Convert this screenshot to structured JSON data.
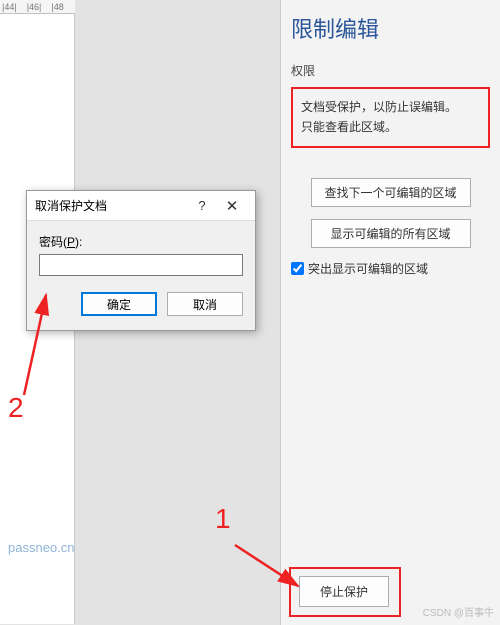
{
  "ruler": {
    "marks": [
      "|44|",
      "|46|",
      "|48"
    ]
  },
  "panel": {
    "title": "限制编辑",
    "subheading": "权限",
    "info_line1": "文档受保护，以防止误编辑。",
    "info_line2": "只能查看此区域。",
    "btn_find": "查找下一个可编辑的区域",
    "btn_show": "显示可编辑的所有区域",
    "chk_highlight": "突出显示可编辑的区域",
    "btn_stop": "停止保护"
  },
  "dialog": {
    "title": "取消保护文档",
    "password_label_pre": "密码(",
    "password_label_u": "P",
    "password_label_post": "):",
    "value": "",
    "ok": "确定",
    "cancel": "取消",
    "help": "?",
    "close": "✕"
  },
  "annotations": {
    "a1": "1",
    "a2": "2"
  },
  "watermark": "passneo.cn",
  "csdn": "CSDN @百事牛"
}
